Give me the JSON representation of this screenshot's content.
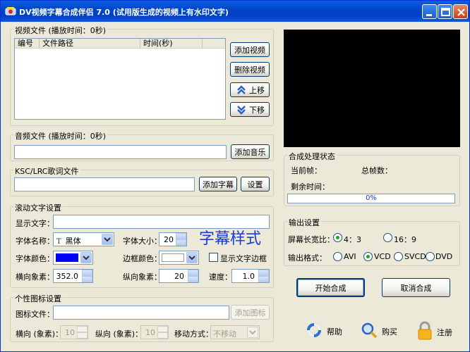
{
  "window": {
    "title": "DV视频字幕合成伴侣 7.0 (试用版生成的视频上有水印文字)"
  },
  "video": {
    "group_title": "视频文件 (播放时间：0秒)",
    "columns": [
      "编号",
      "文件路径",
      "时间(秒)"
    ],
    "add_button": "添加视频",
    "delete_button": "删除视频",
    "up_button": "上移",
    "down_button": "下移"
  },
  "audio": {
    "group_title": "音频文件 (播放时间：0秒)",
    "path_value": "",
    "add_button": "添加音乐"
  },
  "lyrics": {
    "group_title": "KSC/LRC歌词文件",
    "path_value": "",
    "add_button": "添加字幕",
    "settings_button": "设置"
  },
  "scroll_text": {
    "group_title": "滚动文字设置",
    "display_label": "显示文字：",
    "display_value": "",
    "font_name_label": "字体名称：",
    "font_name_value": "黑体",
    "font_size_label": "字体大小：",
    "font_size_value": "20",
    "style_preview": "字幕样式",
    "font_color_label": "字体颜色：",
    "font_color": "#0000ff",
    "border_color_label": "边框颜色：",
    "border_color": "#ffffff",
    "show_border_label": "显示文字边框",
    "show_border_checked": false,
    "x_label": "横向象素：",
    "x_value": "352.0",
    "y_label": "纵向象素：",
    "y_value": "20",
    "speed_label": "速度：",
    "speed_value": "1.0"
  },
  "logo": {
    "group_title": "个性图标设置",
    "file_label": "图标文件：",
    "file_value": "",
    "add_button": "添加图标",
    "x_label": "横向 (象素)：",
    "x_value": "10",
    "y_label": "纵向 (象素)：",
    "y_value": "10",
    "move_label": "移动方式：",
    "move_value": "不移动"
  },
  "status": {
    "group_title": "合成处理状态",
    "current_frame_label": "当前帧：",
    "total_frames_label": "总帧数：",
    "remaining_label": "剩余时间：",
    "progress_text": "0%",
    "progress": 0
  },
  "output": {
    "group_title": "输出设置",
    "aspect_label": "屏幕长宽比：",
    "aspect_options": [
      "4：3",
      "16：9"
    ],
    "aspect_selected": 0,
    "format_label": "输出格式：",
    "format_options": [
      "AVI",
      "VCD",
      "SVCD",
      "DVD"
    ],
    "format_selected": 1
  },
  "actions": {
    "start_button": "开始合成",
    "cancel_button": "取消合成",
    "help_label": "帮助",
    "buy_label": "购买",
    "register_label": "注册"
  }
}
